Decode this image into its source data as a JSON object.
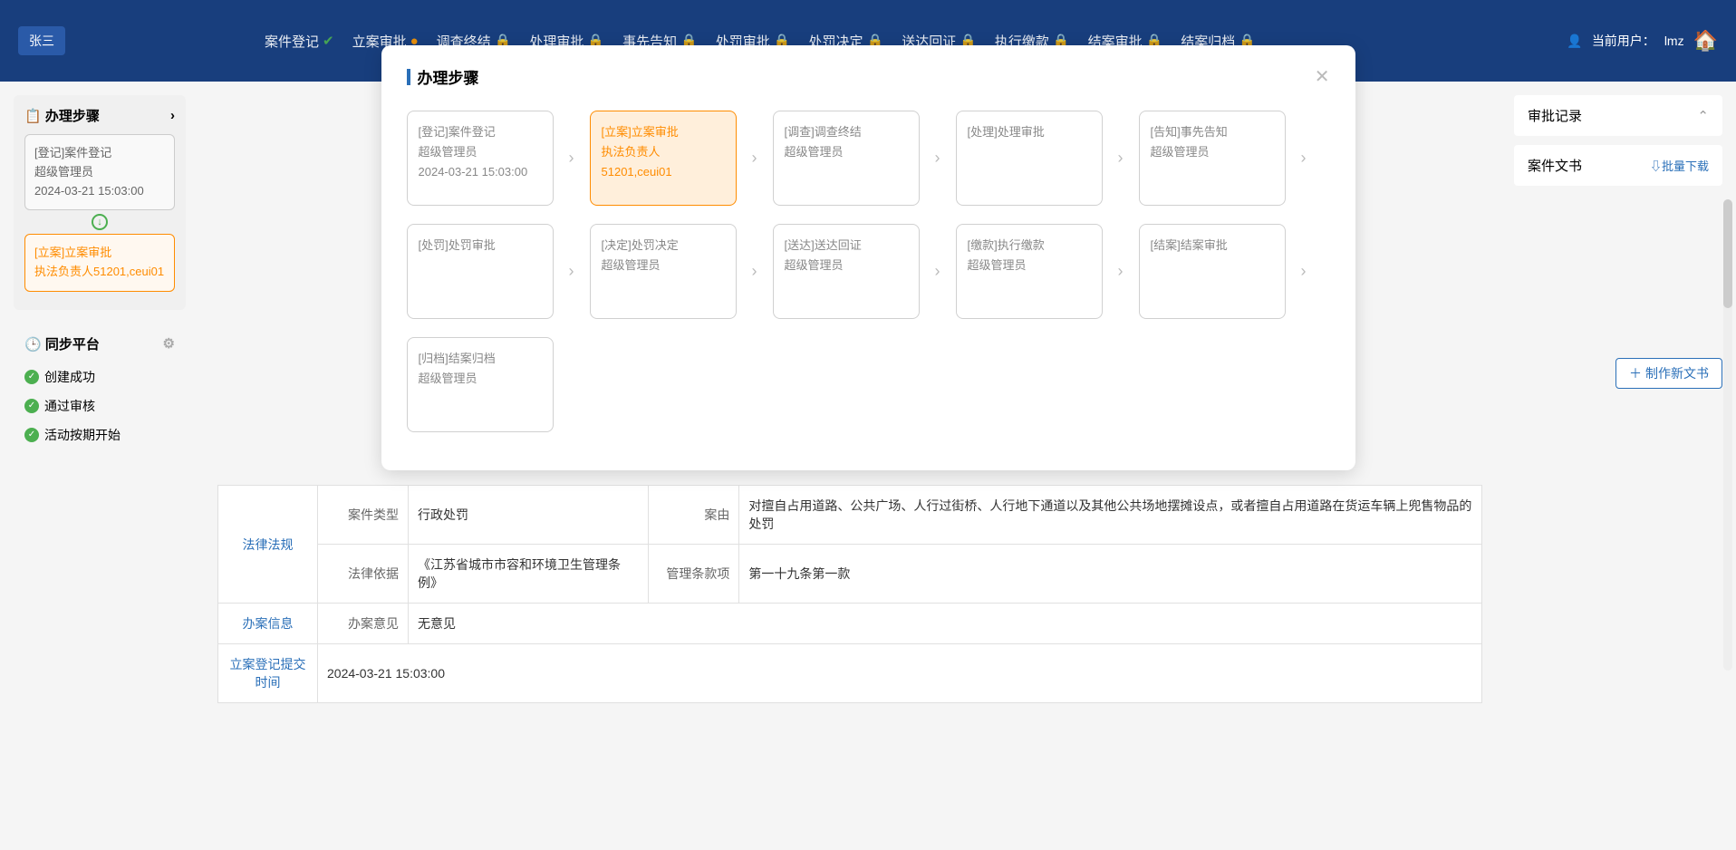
{
  "header": {
    "user_name": "张三",
    "nav": [
      {
        "label": "案件登记",
        "icon": "check"
      },
      {
        "label": "立案审批",
        "icon": "warn"
      },
      {
        "label": "调查终结",
        "icon": "lock"
      },
      {
        "label": "处理审批",
        "icon": "lock"
      },
      {
        "label": "事先告知",
        "icon": "lock"
      },
      {
        "label": "处罚审批",
        "icon": "lock"
      },
      {
        "label": "处罚决定",
        "icon": "lock"
      },
      {
        "label": "送达回证",
        "icon": "lock"
      },
      {
        "label": "执行缴款",
        "icon": "lock"
      },
      {
        "label": "结案审批",
        "icon": "lock"
      },
      {
        "label": "结案归档",
        "icon": "lock"
      }
    ],
    "current_user_label": "当前用户：",
    "current_user": "lmz"
  },
  "sidebar": {
    "steps_title": "办理步骤",
    "step1": {
      "title": "[登记]案件登记",
      "assignee": "超级管理员",
      "time": "2024-03-21 15:03:00"
    },
    "step2": {
      "title": "[立案]立案审批",
      "assignee": "执法负责人51201,ceui01"
    },
    "sync_title": "同步平台",
    "sync_items": [
      "创建成功",
      "通过审核",
      "活动按期开始"
    ]
  },
  "content": {
    "rows": {
      "law": {
        "header": "法律法规",
        "case_type_label": "案件类型",
        "case_type_value": "行政处罚",
        "cause_label": "案由",
        "cause_value": "对擅自占用道路、公共广场、人行过街桥、人行地下通道以及其他公共场地摆摊设点，或者擅自占用道路在货运车辆上兜售物品的处罚",
        "basis_label": "法律依据",
        "basis_value": "《江苏省城市市容和环境卫生管理条例》",
        "clause_label": "管理条款项",
        "clause_value": "第一十九条第一款"
      },
      "handle": {
        "header": "办案信息",
        "opinion_label": "办案意见",
        "opinion_value": "无意见"
      },
      "submit": {
        "header": "立案登记提交时间",
        "value": "2024-03-21 15:03:00"
      }
    }
  },
  "right": {
    "approval_title": "审批记录",
    "docs_title": "案件文书",
    "batch_download": "批量下载",
    "make_doc": "制作新文书"
  },
  "modal": {
    "title": "办理步骤",
    "steps": [
      {
        "title": "[登记]案件登记",
        "assignee": "超级管理员",
        "time": "2024-03-21 15:03:00",
        "active": false
      },
      {
        "title": "[立案]立案审批",
        "assignee": "执法负责人51201,ceui01",
        "time": "",
        "active": true
      },
      {
        "title": "[调查]调查终结",
        "assignee": "超级管理员",
        "time": "",
        "active": false
      },
      {
        "title": "[处理]处理审批",
        "assignee": "",
        "time": "",
        "active": false
      },
      {
        "title": "[告知]事先告知",
        "assignee": "超级管理员",
        "time": "",
        "active": false
      },
      {
        "title": "[处罚]处罚审批",
        "assignee": "",
        "time": "",
        "active": false
      },
      {
        "title": "[决定]处罚决定",
        "assignee": "超级管理员",
        "time": "",
        "active": false
      },
      {
        "title": "[送达]送达回证",
        "assignee": "超级管理员",
        "time": "",
        "active": false
      },
      {
        "title": "[缴款]执行缴款",
        "assignee": "超级管理员",
        "time": "",
        "active": false
      },
      {
        "title": "[结案]结案审批",
        "assignee": "",
        "time": "",
        "active": false
      },
      {
        "title": "[归档]结案归档",
        "assignee": "超级管理员",
        "time": "",
        "active": false
      }
    ]
  }
}
